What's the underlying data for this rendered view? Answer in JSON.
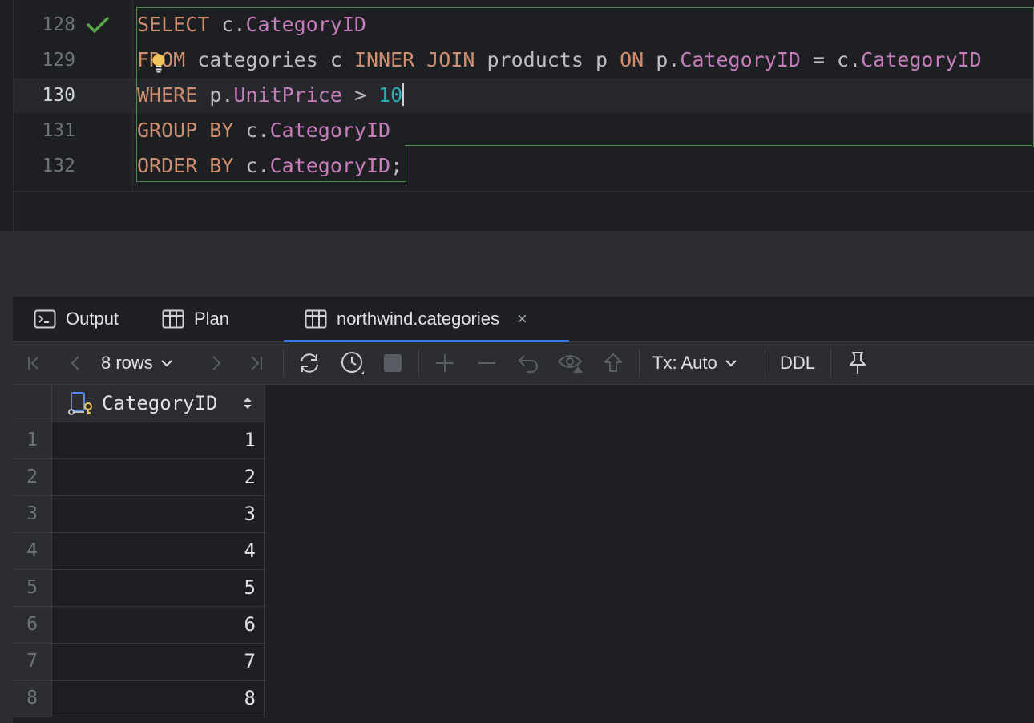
{
  "editor": {
    "lines": [
      {
        "number": "128",
        "status": "check-icon"
      },
      {
        "number": "129"
      },
      {
        "number": "130",
        "current": true
      },
      {
        "number": "131"
      },
      {
        "number": "132"
      }
    ],
    "code": {
      "l128": {
        "kw": "SELECT",
        "t1": " c.",
        "col": "CategoryID"
      },
      "l129": {
        "kw1": "FROM",
        "t1": " categories c ",
        "kw2": "INNER JOIN",
        "t2": " products p ",
        "kw3": "ON",
        "t3": " p.",
        "col1": "CategoryID",
        "t4": " = c.",
        "col2": "CategoryID"
      },
      "l130": {
        "kw": "WHERE",
        "t1": " p.",
        "col": "UnitPrice",
        "t2": " > ",
        "num": "10"
      },
      "l131": {
        "kw": "GROUP BY",
        "t1": " c.",
        "col": "CategoryID"
      },
      "l132": {
        "kw": "ORDER BY",
        "t1": " c.",
        "col": "CategoryID",
        "t2": ";"
      }
    }
  },
  "results": {
    "tabs": [
      {
        "label": "Output",
        "icon": "console-icon"
      },
      {
        "label": "Plan",
        "icon": "table-icon"
      },
      {
        "label": "northwind.categories",
        "icon": "table-icon",
        "active": true,
        "close": "×"
      }
    ],
    "toolbar": {
      "rows_label": "8 rows",
      "tx_label": "Tx: Auto",
      "ddl_label": "DDL"
    },
    "grid": {
      "column": "CategoryID",
      "rows": [
        {
          "n": "1",
          "v": "1"
        },
        {
          "n": "2",
          "v": "2"
        },
        {
          "n": "3",
          "v": "3"
        },
        {
          "n": "4",
          "v": "4"
        },
        {
          "n": "5",
          "v": "5"
        },
        {
          "n": "6",
          "v": "6"
        },
        {
          "n": "7",
          "v": "7"
        },
        {
          "n": "8",
          "v": "8"
        }
      ]
    }
  },
  "colors": {
    "keyword": "#cf8e6d",
    "column": "#c77dbb",
    "number": "#2aacb8",
    "accent": "#3574f0",
    "statement_box": "#4f8a4a"
  }
}
